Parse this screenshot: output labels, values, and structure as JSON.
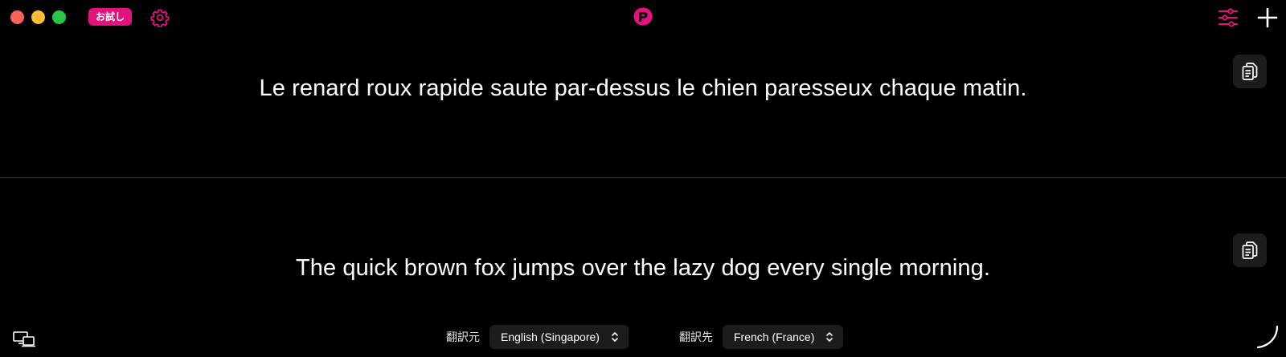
{
  "window": {
    "traffic_lights": [
      "close",
      "minimize",
      "zoom"
    ]
  },
  "toolbar": {
    "trial_badge": "お試し",
    "settings_icon": "gear-icon",
    "logo_icon": "app-logo",
    "filters_icon": "sliders-icon",
    "add_icon": "plus-icon",
    "accent_color": "#e3127d"
  },
  "panes": {
    "source": {
      "text": "Le renard roux rapide saute par-dessus le chien paresseux chaque matin.",
      "copy_icon": "copy-icon"
    },
    "target": {
      "text": "The quick brown fox jumps over the lazy dog every single morning.",
      "copy_icon": "copy-icon"
    }
  },
  "footer": {
    "source_label": "翻訳元",
    "source_language": "English (Singapore)",
    "target_label": "翻訳先",
    "target_language": "French (France)",
    "screen_icon": "display-icon",
    "resize_icon": "resize-corner-icon"
  }
}
